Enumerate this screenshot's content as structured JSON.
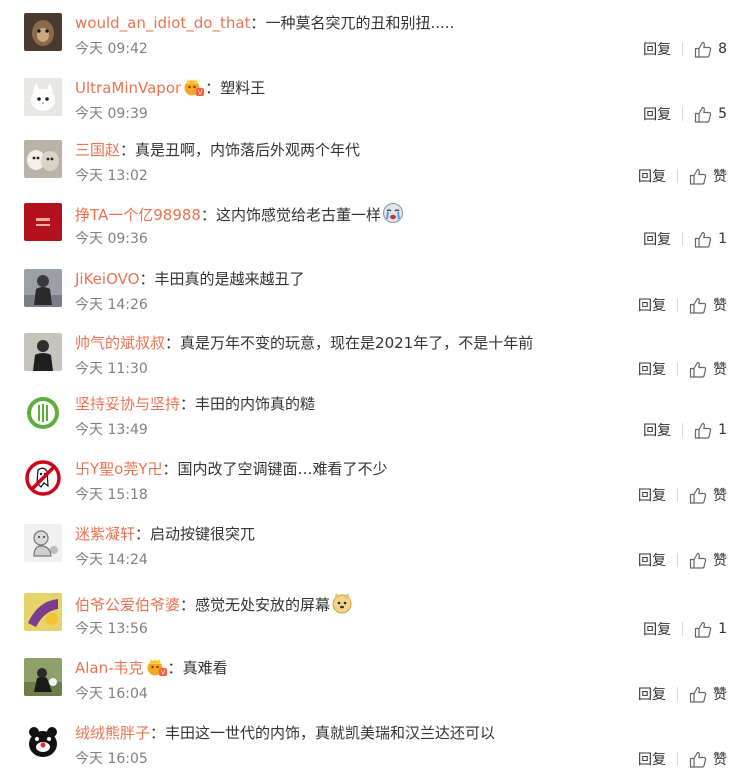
{
  "colors": {
    "username": "#eb7350",
    "time": "#808080",
    "text": "#333333"
  },
  "comments": [
    {
      "user": "would_an_idiot_do_that",
      "sep": "：",
      "badge": false,
      "text": "一种莫名突兀的丑和别扭.....",
      "emoji": "",
      "time": "今天 09:42",
      "reply": "回复",
      "like": "8"
    },
    {
      "user": "UltraMinVapor",
      "sep": "：",
      "badge": true,
      "text": "塑料王",
      "emoji": "",
      "time": "今天 09:39",
      "reply": "回复",
      "like": "5"
    },
    {
      "user": "三国赵",
      "sep": "：",
      "badge": false,
      "text": "真是丑啊，内饰落后外观两个年代",
      "emoji": "",
      "time": "今天 13:02",
      "reply": "回复",
      "like": "赞"
    },
    {
      "user": "挣TA一个亿98988",
      "sep": "：",
      "badge": false,
      "text": "这内饰感觉给老古董一样",
      "emoji": "crying-face-emoji",
      "time": "今天 09:36",
      "reply": "回复",
      "like": "1"
    },
    {
      "user": "JiKeiOVO",
      "sep": "：",
      "badge": false,
      "text": "丰田真的是越来越丑了",
      "emoji": "",
      "time": "今天 14:26",
      "reply": "回复",
      "like": "赞"
    },
    {
      "user": "帅气的斌叔叔",
      "sep": "：",
      "badge": false,
      "text": "真是万年不变的玩意，现在是2021年了，不是十年前",
      "emoji": "",
      "time": "今天 11:30",
      "reply": "回复",
      "like": "赞"
    },
    {
      "user": "坚持妥协与坚持",
      "sep": "：",
      "badge": false,
      "text": "丰田的内饰真的糙",
      "emoji": "",
      "time": "今天 13:49",
      "reply": "回复",
      "like": "1"
    },
    {
      "user": "卐Y聖o莞Y卍",
      "sep": "：",
      "badge": false,
      "text": "国内改了空调键面…难看了不少",
      "emoji": "",
      "time": "今天 15:18",
      "reply": "回复",
      "like": "赞"
    },
    {
      "user": "迷紫凝轩",
      "sep": "：",
      "badge": false,
      "text": "启动按键很突兀",
      "emoji": "",
      "time": "今天 14:24",
      "reply": "回复",
      "like": "赞"
    },
    {
      "user": "伯爷公爱伯爷婆",
      "sep": "：",
      "badge": false,
      "text": "感觉无处安放的屏幕",
      "emoji": "doge-emoji",
      "time": "今天 13:56",
      "reply": "回复",
      "like": "1"
    },
    {
      "user": "Alan-韦克",
      "sep": "：",
      "badge": true,
      "text": "真难看",
      "emoji": "",
      "time": "今天 16:04",
      "reply": "回复",
      "like": "赞"
    },
    {
      "user": "绒绒熊胖子",
      "sep": "：",
      "badge": false,
      "text": "丰田这一世代的内饰，真就凯美瑞和汉兰达还可以",
      "emoji": "",
      "time": "今天 16:05",
      "reply": "回复",
      "like": "赞"
    }
  ]
}
